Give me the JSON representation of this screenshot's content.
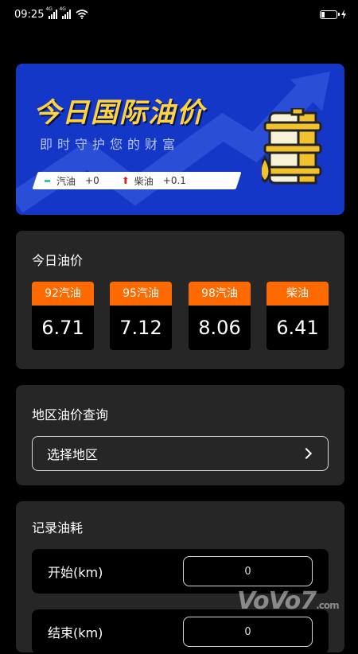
{
  "status_bar": {
    "time": "09:25",
    "net1": "4G",
    "net2": "4G"
  },
  "banner": {
    "title": "今日国际油价",
    "subtitle": "即时守护您的财富",
    "gasoline_label": "汽油",
    "gasoline_change": "+0",
    "diesel_label": "柴油",
    "diesel_change": "+0.1"
  },
  "today": {
    "title": "今日油价",
    "prices": [
      {
        "name": "92汽油",
        "value": "6.71"
      },
      {
        "name": "95汽油",
        "value": "7.12"
      },
      {
        "name": "98汽油",
        "value": "8.06"
      },
      {
        "name": "柴油",
        "value": "6.41"
      }
    ]
  },
  "region": {
    "title": "地区油价查询",
    "select_label": "选择地区"
  },
  "record": {
    "title": "记录油耗",
    "start_label": "开始(km)",
    "start_value": "0",
    "end_label": "结束(km)",
    "end_value": "0"
  },
  "watermark": {
    "text": "VoVo7",
    "suffix": ".com"
  },
  "colors": {
    "banner_bg": "#1437c8",
    "accent": "#ff6a00",
    "card_bg": "#262626",
    "title_yellow": "#ffd33d"
  }
}
